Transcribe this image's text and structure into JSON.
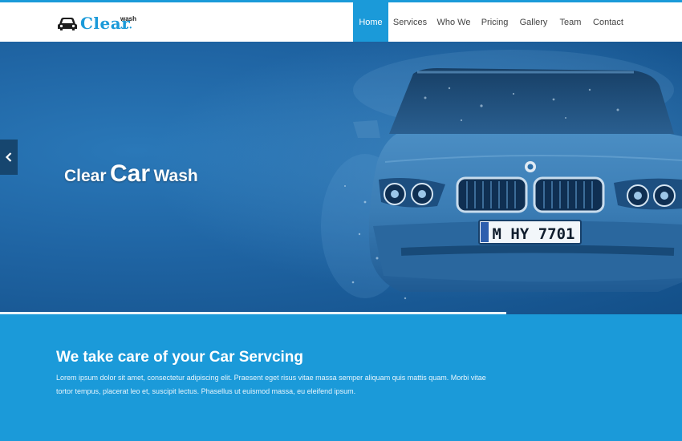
{
  "brand": {
    "name": "Clear",
    "sub": "wash",
    "dots": "••••",
    "icon": "car-icon"
  },
  "nav": {
    "items": [
      {
        "label": "Home",
        "active": true
      },
      {
        "label": "Services",
        "active": false
      },
      {
        "label": "Who We",
        "active": false
      },
      {
        "label": "Pricing",
        "active": false
      },
      {
        "label": "Gallery",
        "active": false
      },
      {
        "label": "Team",
        "active": false
      },
      {
        "label": "Contact",
        "active": false
      }
    ]
  },
  "hero": {
    "title": {
      "w1": "Clear",
      "w2": "Car",
      "w3": "Wash"
    },
    "license_plate": "M HY 7701",
    "prev_icon": "chevron-left-icon"
  },
  "intro": {
    "title": "We take care of your Car Servcing",
    "text": "Lorem ipsum dolor sit amet, consectetur adipiscing elit. Praesent eget risus vitae massa semper aliquam quis mattis quam. Morbi vitae tortor tempus, placerat leo et, suscipit lectus. Phasellus ut euismod massa, eu eleifend ipsum."
  },
  "colors": {
    "accent": "#1b9ad9",
    "hero_dark": "#134f88",
    "arrow_bg": "#16466f"
  }
}
